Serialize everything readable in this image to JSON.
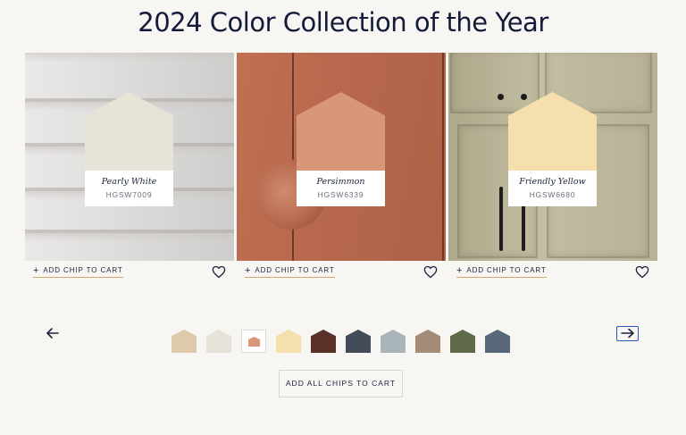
{
  "page": {
    "title": "2024 Color Collection of the Year"
  },
  "cards": [
    {
      "name": "Pearly White",
      "code": "HGSW7009",
      "chip_color": "#e6e3d8",
      "add_label": "ADD CHIP TO CART"
    },
    {
      "name": "Persimmon",
      "code": "HGSW6339",
      "chip_color": "#d9977a",
      "add_label": "ADD CHIP TO CART"
    },
    {
      "name": "Friendly Yellow",
      "code": "HGSW6680",
      "chip_color": "#f5dfac",
      "add_label": "ADD CHIP TO CART"
    }
  ],
  "icons": {
    "plus": "+",
    "heart": "heart-outline-icon",
    "prev": "arrow-left-icon",
    "next": "arrow-right-icon"
  },
  "swatches": [
    "#dfc9ac",
    "#e6e3da",
    "#d9977a",
    "#f5dfac",
    "#5a3128",
    "#454c59",
    "#a8b4ba",
    "#a38b76",
    "#5f6b48",
    "#58687a"
  ],
  "selected_swatch": 2,
  "add_all_label": "ADD ALL CHIPS TO CART",
  "colors": {
    "accent_underline": "#d6a76a",
    "focus_outline": "#2a57c5",
    "text": "#1c2340"
  }
}
